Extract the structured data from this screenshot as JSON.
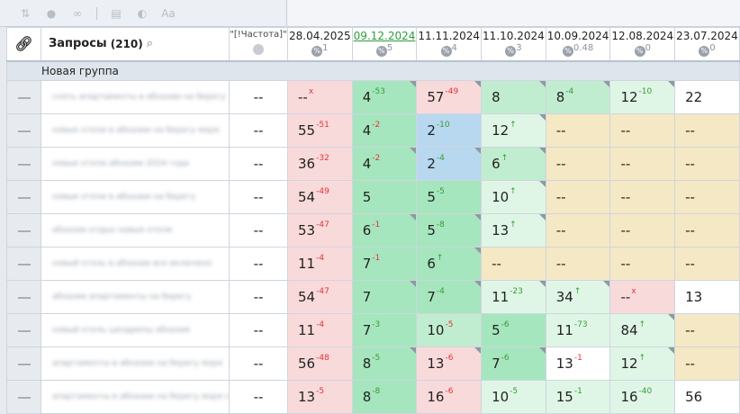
{
  "toolbar": {
    "icons": [
      "sort-icon",
      "eye-icon",
      "link-icon",
      "table-icon",
      "contrast-icon",
      "text-size-icon"
    ]
  },
  "header": {
    "title": "Запросы",
    "count": "(210)",
    "frequency_label": "\"[!Частота]\"",
    "dates": [
      {
        "date": "28.04.2025",
        "sub": "1",
        "link": false
      },
      {
        "date": "09.12.2024",
        "sub": "5",
        "link": true
      },
      {
        "date": "11.11.2024",
        "sub": "4",
        "link": false
      },
      {
        "date": "11.10.2024",
        "sub": "3",
        "link": false
      },
      {
        "date": "10.09.2024",
        "sub": "0.48",
        "link": false
      },
      {
        "date": "12.08.2024",
        "sub": "0",
        "link": false
      },
      {
        "date": "23.07.2024",
        "sub": "0",
        "link": false
      }
    ]
  },
  "group": {
    "name": "Новая группа"
  },
  "rows": [
    {
      "keyword": "снять апартаменты в абхазии на берегу",
      "freq": "--",
      "cells": [
        {
          "v": "--",
          "d": "x",
          "t": "x",
          "bg": "pink"
        },
        {
          "v": "4",
          "d": "-53",
          "t": "up",
          "bg": "green"
        },
        {
          "v": "57",
          "d": "-49",
          "t": "dn",
          "bg": "pink"
        },
        {
          "v": "8",
          "d": "",
          "t": "",
          "bg": "green2"
        },
        {
          "v": "8",
          "d": "-4",
          "t": "up",
          "bg": "green2"
        },
        {
          "v": "12",
          "d": "-10",
          "t": "up",
          "bg": "lg"
        },
        {
          "v": "22",
          "d": "",
          "t": "",
          "bg": "white"
        }
      ]
    },
    {
      "keyword": "новые отели в абхазии на берегу моря",
      "freq": "--",
      "cells": [
        {
          "v": "55",
          "d": "-51",
          "t": "dn",
          "bg": "pink"
        },
        {
          "v": "4",
          "d": "-2",
          "t": "dn",
          "bg": "green"
        },
        {
          "v": "2",
          "d": "-10",
          "t": "up",
          "bg": "blue"
        },
        {
          "v": "12",
          "d": "↑",
          "t": "up",
          "bg": "lg"
        },
        {
          "v": "--",
          "d": "",
          "t": "",
          "bg": "tan"
        },
        {
          "v": "--",
          "d": "",
          "t": "",
          "bg": "tan"
        },
        {
          "v": "--",
          "d": "",
          "t": "",
          "bg": "tan"
        }
      ]
    },
    {
      "keyword": "новые отели абхазии 2024 года",
      "freq": "--",
      "cells": [
        {
          "v": "36",
          "d": "-32",
          "t": "dn",
          "bg": "pink"
        },
        {
          "v": "4",
          "d": "-2",
          "t": "dn",
          "bg": "green"
        },
        {
          "v": "2",
          "d": "-4",
          "t": "up",
          "bg": "blue"
        },
        {
          "v": "6",
          "d": "↑",
          "t": "up",
          "bg": "green2"
        },
        {
          "v": "--",
          "d": "",
          "t": "",
          "bg": "tan"
        },
        {
          "v": "--",
          "d": "",
          "t": "",
          "bg": "tan"
        },
        {
          "v": "--",
          "d": "",
          "t": "",
          "bg": "tan"
        }
      ]
    },
    {
      "keyword": "новые отели в абхазии на берегу",
      "freq": "--",
      "cells": [
        {
          "v": "54",
          "d": "-49",
          "t": "dn",
          "bg": "pink"
        },
        {
          "v": "5",
          "d": "",
          "t": "",
          "bg": "green"
        },
        {
          "v": "5",
          "d": "-5",
          "t": "up",
          "bg": "green"
        },
        {
          "v": "10",
          "d": "↑",
          "t": "up",
          "bg": "lg"
        },
        {
          "v": "--",
          "d": "",
          "t": "",
          "bg": "tan"
        },
        {
          "v": "--",
          "d": "",
          "t": "",
          "bg": "tan"
        },
        {
          "v": "--",
          "d": "",
          "t": "",
          "bg": "tan"
        }
      ]
    },
    {
      "keyword": "абхазия отдых новые отели",
      "freq": "--",
      "cells": [
        {
          "v": "53",
          "d": "-47",
          "t": "dn",
          "bg": "pink"
        },
        {
          "v": "6",
          "d": "-1",
          "t": "dn",
          "bg": "green"
        },
        {
          "v": "5",
          "d": "-8",
          "t": "up",
          "bg": "green"
        },
        {
          "v": "13",
          "d": "↑",
          "t": "up",
          "bg": "lg"
        },
        {
          "v": "--",
          "d": "",
          "t": "",
          "bg": "tan"
        },
        {
          "v": "--",
          "d": "",
          "t": "",
          "bg": "tan"
        },
        {
          "v": "--",
          "d": "",
          "t": "",
          "bg": "tan"
        }
      ]
    },
    {
      "keyword": "новый отель в абхазии все включено",
      "freq": "--",
      "cells": [
        {
          "v": "11",
          "d": "-4",
          "t": "dn",
          "bg": "pink"
        },
        {
          "v": "7",
          "d": "-1",
          "t": "dn",
          "bg": "green"
        },
        {
          "v": "6",
          "d": "↑",
          "t": "up",
          "bg": "green"
        },
        {
          "v": "--",
          "d": "",
          "t": "",
          "bg": "tan"
        },
        {
          "v": "--",
          "d": "",
          "t": "",
          "bg": "tan"
        },
        {
          "v": "--",
          "d": "",
          "t": "",
          "bg": "tan"
        },
        {
          "v": "--",
          "d": "",
          "t": "",
          "bg": "tan"
        }
      ]
    },
    {
      "keyword": "абхазия апартаменты на берегу",
      "freq": "--",
      "cells": [
        {
          "v": "54",
          "d": "-47",
          "t": "dn",
          "bg": "pink"
        },
        {
          "v": "7",
          "d": "",
          "t": "",
          "bg": "green"
        },
        {
          "v": "7",
          "d": "-4",
          "t": "up",
          "bg": "green"
        },
        {
          "v": "11",
          "d": "-23",
          "t": "up",
          "bg": "lg"
        },
        {
          "v": "34",
          "d": "↑",
          "t": "up",
          "bg": "lg"
        },
        {
          "v": "--",
          "d": "x",
          "t": "x",
          "bg": "pink"
        },
        {
          "v": "13",
          "d": "",
          "t": "",
          "bg": "white"
        }
      ]
    },
    {
      "keyword": "новый отель цандрипш абхазия",
      "freq": "--",
      "cells": [
        {
          "v": "11",
          "d": "-4",
          "t": "dn",
          "bg": "pink"
        },
        {
          "v": "7",
          "d": "-3",
          "t": "up",
          "bg": "green"
        },
        {
          "v": "10",
          "d": "-5",
          "t": "dn",
          "bg": "green2"
        },
        {
          "v": "5",
          "d": "-6",
          "t": "up",
          "bg": "green"
        },
        {
          "v": "11",
          "d": "-73",
          "t": "up",
          "bg": "lg"
        },
        {
          "v": "84",
          "d": "↑",
          "t": "up",
          "bg": "lg"
        },
        {
          "v": "--",
          "d": "",
          "t": "",
          "bg": "tan"
        }
      ]
    },
    {
      "keyword": "апартаменты в абхазии на берегу моря",
      "freq": "--",
      "cells": [
        {
          "v": "56",
          "d": "-48",
          "t": "dn",
          "bg": "pink"
        },
        {
          "v": "8",
          "d": "-5",
          "t": "up",
          "bg": "green"
        },
        {
          "v": "13",
          "d": "-6",
          "t": "dn",
          "bg": "pink"
        },
        {
          "v": "7",
          "d": "-6",
          "t": "up",
          "bg": "green"
        },
        {
          "v": "13",
          "d": "-1",
          "t": "dn",
          "bg": "white"
        },
        {
          "v": "12",
          "d": "↑",
          "t": "up",
          "bg": "lg"
        },
        {
          "v": "--",
          "d": "",
          "t": "",
          "bg": "tan"
        }
      ]
    },
    {
      "keyword": "апартаменты в абхазии на берегу моря снять",
      "freq": "--",
      "cells": [
        {
          "v": "13",
          "d": "-5",
          "t": "dn",
          "bg": "pink"
        },
        {
          "v": "8",
          "d": "-8",
          "t": "up",
          "bg": "green"
        },
        {
          "v": "16",
          "d": "-6",
          "t": "dn",
          "bg": "pink"
        },
        {
          "v": "10",
          "d": "-5",
          "t": "up",
          "bg": "lg"
        },
        {
          "v": "15",
          "d": "-1",
          "t": "up",
          "bg": "lg"
        },
        {
          "v": "16",
          "d": "-40",
          "t": "up",
          "bg": "lg"
        },
        {
          "v": "56",
          "d": "",
          "t": "",
          "bg": "white"
        }
      ]
    }
  ],
  "colors": {
    "pink": "#f9dadb",
    "green": "#a6e6be",
    "green2": "#c0edcf",
    "lg": "#dff6e6",
    "blue": "#b7d8ef",
    "tan": "#f5e8c4",
    "white": "#ffffff",
    "up": "#3a9a3a",
    "down": "#e0343a"
  }
}
